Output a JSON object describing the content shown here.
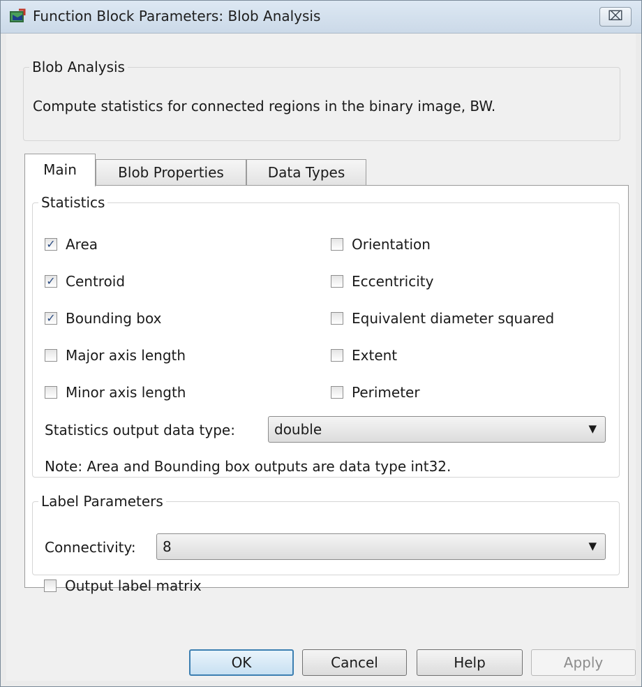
{
  "window": {
    "title": "Function Block Parameters: Blob Analysis",
    "close_glyph": "⌧"
  },
  "description": {
    "group_title": "Blob Analysis",
    "text": "Compute statistics for connected regions in the binary image, BW."
  },
  "tabs": [
    {
      "label": "Main",
      "active": true
    },
    {
      "label": "Blob Properties",
      "active": false
    },
    {
      "label": "Data Types",
      "active": false
    }
  ],
  "statistics": {
    "group_title": "Statistics",
    "left_checks": [
      {
        "label": "Area",
        "checked": true,
        "mark": "✓"
      },
      {
        "label": "Centroid",
        "checked": true,
        "mark": "✓"
      },
      {
        "label": "Bounding box",
        "checked": true,
        "mark": "✓"
      },
      {
        "label": "Major axis length",
        "checked": false,
        "mark": ""
      },
      {
        "label": "Minor axis length",
        "checked": false,
        "mark": ""
      }
    ],
    "right_checks": [
      {
        "label": "Orientation",
        "checked": false,
        "mark": ""
      },
      {
        "label": "Eccentricity",
        "checked": false,
        "mark": ""
      },
      {
        "label": "Equivalent diameter squared",
        "checked": false,
        "mark": ""
      },
      {
        "label": "Extent",
        "checked": false,
        "mark": ""
      },
      {
        "label": "Perimeter",
        "checked": false,
        "mark": ""
      }
    ],
    "output_type_label": "Statistics output data type:",
    "output_type_value": "double",
    "note": "Note:  Area and Bounding box outputs are data type int32."
  },
  "label_params": {
    "group_title": "Label Parameters",
    "connectivity_label": "Connectivity:",
    "connectivity_value": "8",
    "output_label_matrix": {
      "label": "Output label matrix",
      "checked": false,
      "mark": ""
    }
  },
  "dropdown_arrow": "▼",
  "buttons": {
    "ok": "OK",
    "cancel": "Cancel",
    "help": "Help",
    "apply": "Apply"
  },
  "colors": {
    "title_bar": "#cbd9e8",
    "default_button_border": "#3c7fb1",
    "check_mark": "#2b4c82"
  }
}
